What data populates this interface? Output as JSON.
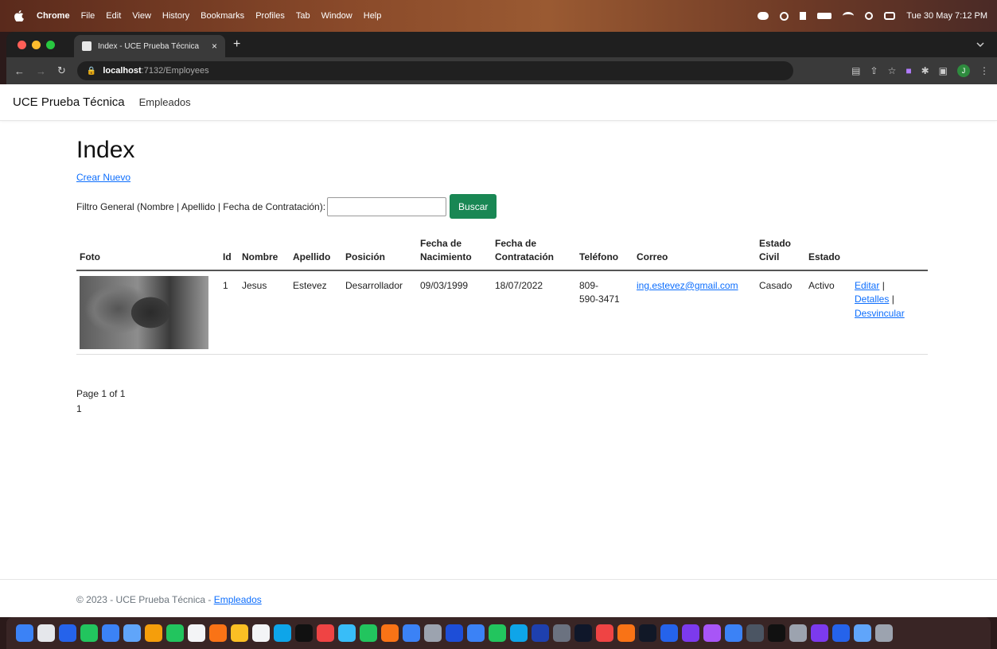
{
  "menubar": {
    "app": "Chrome",
    "items": [
      "File",
      "Edit",
      "View",
      "History",
      "Bookmarks",
      "Profiles",
      "Tab",
      "Window",
      "Help"
    ],
    "clock": "Tue 30 May  7:12 PM"
  },
  "browser": {
    "tab_title": "Index - UCE Prueba Técnica",
    "tab_close": "×",
    "new_tab": "+",
    "url_host": "localhost",
    "url_rest": ":7132/Employees",
    "avatar_letter": "J",
    "traffic_colors": [
      "#ff5f57",
      "#febc2e",
      "#28c840"
    ]
  },
  "navbar": {
    "brand": "UCE Prueba Técnica",
    "link": "Empleados"
  },
  "page": {
    "title": "Index",
    "create_link": "Crear Nuevo",
    "filter_label": "Filtro General (Nombre | Apellido | Fecha de Contratación):",
    "filter_value": "",
    "search_button": "Buscar"
  },
  "table": {
    "headers": {
      "foto": "Foto",
      "id": "Id",
      "nombre": "Nombre",
      "apellido": "Apellido",
      "posicion": "Posición",
      "nacimiento_1": "Fecha de",
      "nacimiento_2": "Nacimiento",
      "contratacion_1": "Fecha de",
      "contratacion_2": "Contratación",
      "telefono": "Teléfono",
      "correo": "Correo",
      "estado_civil_1": "Estado",
      "estado_civil_2": "Civil",
      "estado": "Estado"
    },
    "rows": [
      {
        "id": "1",
        "nombre": "Jesus",
        "apellido": "Estevez",
        "posicion": "Desarrollador",
        "nacimiento": "09/03/1999",
        "contratacion": "18/07/2022",
        "telefono_1": "809-",
        "telefono_2": "590-3471",
        "correo": "ing.estevez@gmail.com",
        "estado_civil": "Casado",
        "estado": "Activo",
        "editar": "Editar",
        "detalles": "Detalles",
        "desvincular": "Desvincular",
        "sep": "|"
      }
    ]
  },
  "pager": {
    "summary": "Page 1 of 1",
    "page": "1"
  },
  "footer": {
    "text": "© 2023 - UCE Prueba Técnica - ",
    "link": "Empleados"
  },
  "dock_colors": [
    "#3b82f6",
    "#e5e7eb",
    "#2563eb",
    "#22c55e",
    "#3b82f6",
    "#60a5fa",
    "#f59e0b",
    "#22c55e",
    "#f3f4f6",
    "#f97316",
    "#fbbf24",
    "#f3f4f6",
    "#0ea5e9",
    "#111111",
    "#ef4444",
    "#38bdf8",
    "#22c55e",
    "#f97316",
    "#3b82f6",
    "#9ca3af",
    "#1d4ed8",
    "#3b82f6",
    "#22c55e",
    "#0ea5e9",
    "#1e40af",
    "#6b7280",
    "#0f172a",
    "#ef4444",
    "#f97316",
    "#111827",
    "#2563eb",
    "#7c3aed",
    "#a855f7",
    "#3b82f6",
    "#4b5563",
    "#111111",
    "#9ca3af",
    "#7c3aed",
    "#2563eb",
    "#60a5fa",
    "#9ca3af"
  ]
}
